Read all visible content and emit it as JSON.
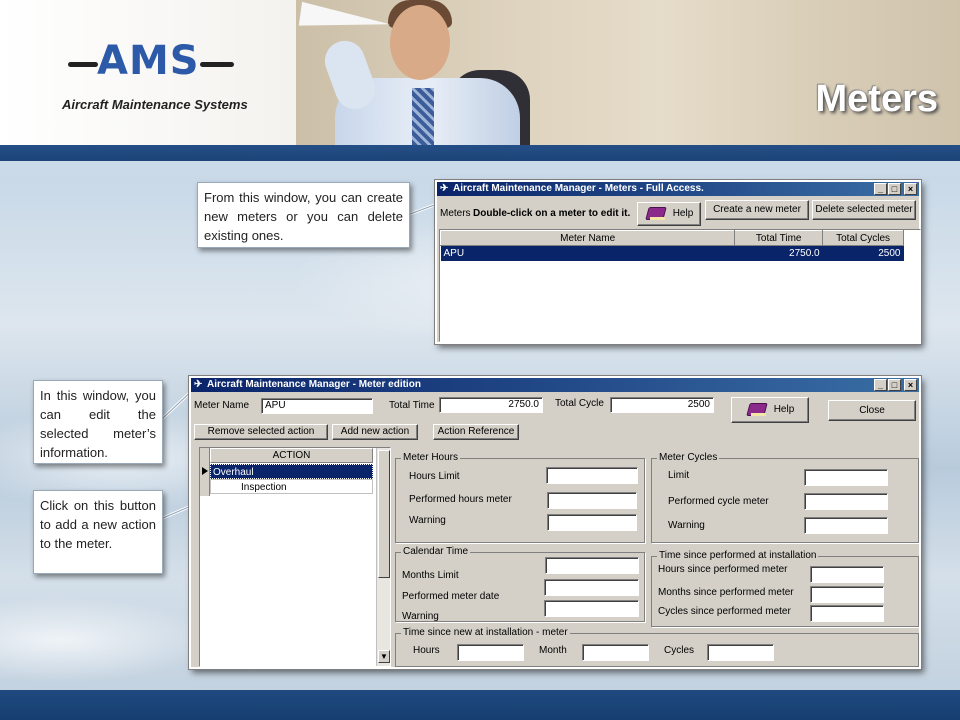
{
  "slide": {
    "title": "Meters",
    "logo": {
      "text": "AMS",
      "subtitle": "Aircraft Maintenance Systems"
    }
  },
  "callouts": [
    "From this window, you can create new meters or you can delete existing ones.",
    "In this window, you can edit the selected meter’s information.",
    "Click on this button to add a new action to the meter."
  ],
  "meters_window": {
    "title": "Aircraft Maintenance Manager - Meters - Full Access.",
    "label": "Meters",
    "hint": "Double-click on a meter to edit it.",
    "help_label": "Help",
    "create_label": "Create a new meter",
    "delete_label": "Delete selected meter",
    "columns": [
      "Meter Name",
      "Total Time",
      "Total Cycles"
    ],
    "rows": [
      {
        "name": "APU",
        "time": "2750.0",
        "cycles": "2500"
      }
    ]
  },
  "edit_window": {
    "title": "Aircraft Maintenance Manager - Meter edition",
    "meter_name_label": "Meter Name",
    "meter_name_value": "APU",
    "total_time_label": "Total Time",
    "total_time_value": "2750.0",
    "total_cycle_label": "Total Cycle",
    "total_cycle_value": "2500",
    "help_label": "Help",
    "close_label": "Close",
    "remove_action_label": "Remove selected action",
    "add_action_label": "Add new action",
    "action_reference_label": "Action Reference",
    "actions_header": "ACTION",
    "actions": [
      "Overhaul",
      "Inspection"
    ],
    "meter_hours": {
      "title": "Meter Hours",
      "hours_limit": "Hours Limit",
      "performed_hours_meter": "Performed hours meter",
      "warning": "Warning"
    },
    "meter_cycles": {
      "title": "Meter Cycles",
      "limit": "Limit",
      "performed_cycle_meter": "Performed cycle meter",
      "warning": "Warning"
    },
    "calendar_time": {
      "title": "Calendar Time",
      "months_limit": "Months Limit",
      "performed_meter_date": "Performed meter date",
      "warning": "Warning"
    },
    "since_installation": {
      "title": "Time since performed at installation",
      "hours": "Hours since performed meter",
      "months": "Months since performed meter",
      "cycles": "Cycles since performed meter"
    },
    "since_new": {
      "title": "Time since new at installation - meter",
      "hours": "Hours",
      "month": "Month",
      "cycles": "Cycles"
    }
  }
}
